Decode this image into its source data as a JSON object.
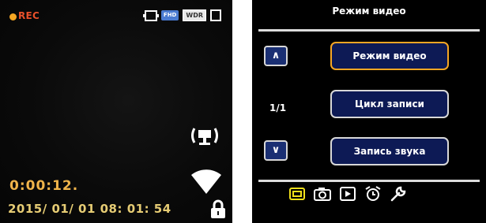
{
  "live_view": {
    "rec_label": "REC",
    "status_icons": [
      "video-mode-icon",
      "fhd-icon",
      "wdr-icon",
      "sd-card-icon"
    ],
    "fhd_text": "FHD",
    "wdr_text": "WDR",
    "elapsed_time": "0:00:12.",
    "datetime": "2015/ 01/ 01 08: 01: 54",
    "side_icons": [
      "signal-icon",
      "wifi-icon",
      "lock-icon"
    ]
  },
  "menu": {
    "title": "Режим видео",
    "nav_up": "∧",
    "nav_down": "∨",
    "page_indicator": "1/1",
    "options": [
      {
        "label": "Режим видео",
        "selected": true
      },
      {
        "label": "Цикл записи",
        "selected": false
      },
      {
        "label": "Запись звука",
        "selected": false
      }
    ],
    "tabs": [
      "video-tab-icon",
      "camera-tab-icon",
      "playback-tab-icon",
      "time-tab-icon",
      "settings-wrench-icon"
    ],
    "active_tab": "video-tab-icon"
  },
  "colors": {
    "rec_dot": "#f5a623",
    "rec_text": "#e8502a",
    "elapsed": "#f0b44a",
    "datetime": "#e6cc74",
    "button_fill": "#0d1a55",
    "selected_border": "#f5a623",
    "active_tab": "#f2e11a"
  }
}
